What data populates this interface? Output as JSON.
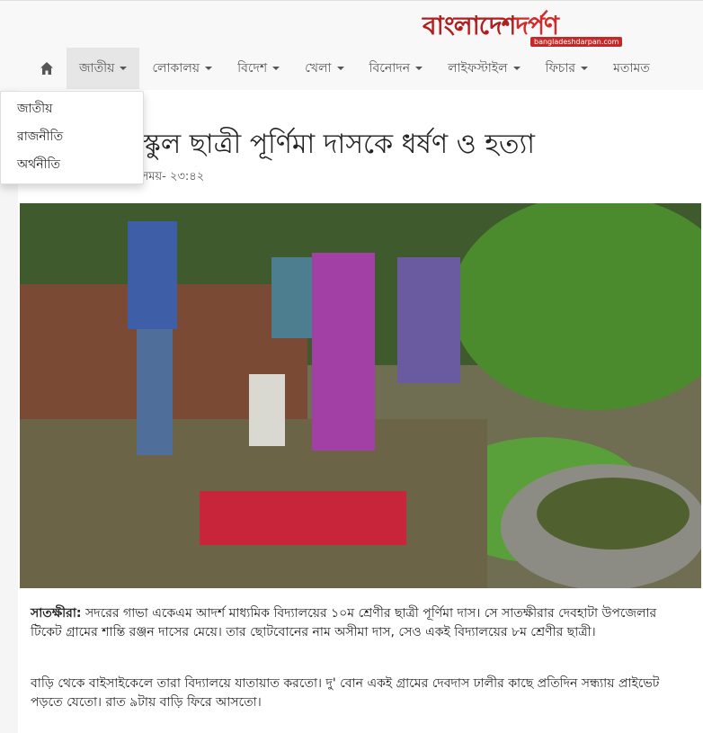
{
  "site": {
    "logo_text_a": "বাংলাদেশ",
    "logo_text_b": "দর্পণ",
    "logo_domain": "bangladeshdarpan.com"
  },
  "nav": {
    "items": [
      {
        "label": "জাতীয়",
        "dropdown": true,
        "active": true
      },
      {
        "label": "লোকালয়",
        "dropdown": true
      },
      {
        "label": "বিদেশ",
        "dropdown": true
      },
      {
        "label": "খেলা",
        "dropdown": true
      },
      {
        "label": "বিনোদন",
        "dropdown": true
      },
      {
        "label": "লাইফস্টাইল",
        "dropdown": true
      },
      {
        "label": "ফিচার",
        "dropdown": true
      },
      {
        "label": "মতামত",
        "dropdown": false
      }
    ],
    "dropdown_items": [
      "জাতীয়",
      "রাজনীতি",
      "অর্থনীতি"
    ]
  },
  "article": {
    "title": "য় স্কুল ছাত্রী পূর্ণিমা দাসকে ধর্ষণ ও হত্যা",
    "meta": "০, সময়- ২৩:৪২",
    "dateline": "সাতক্ষীরা:",
    "para1": " সদরের গাভা একেএম আদর্শ মাধ্যমিক বিদ্যালয়ের ১০ম শ্রেণীর ছাত্রী পূর্ণিমা দাস। সে সাতক্ষীরার দেবহাটা উপজেলার টিকেট গ্রামের শান্তি রঞ্জন দাসের মেয়ে। তার ছোটবোনের নাম অসীমা দাস, সেও একই বিদ্যালয়ের ৮ম শ্রেণীর ছাত্রী।",
    "para2": "বাড়ি থেকে বাইসাইকেলে তারা বিদ্যালয়ে যাতায়াত করতো। দু' বোন একই গ্রামের দেবদাস ঢালীর কাছে প্রতিদিন সন্ধ্যায় প্রাইভেট পড়তে যেতো। রাত ৯টায় বাড়ি ফিরে আসতো।"
  }
}
